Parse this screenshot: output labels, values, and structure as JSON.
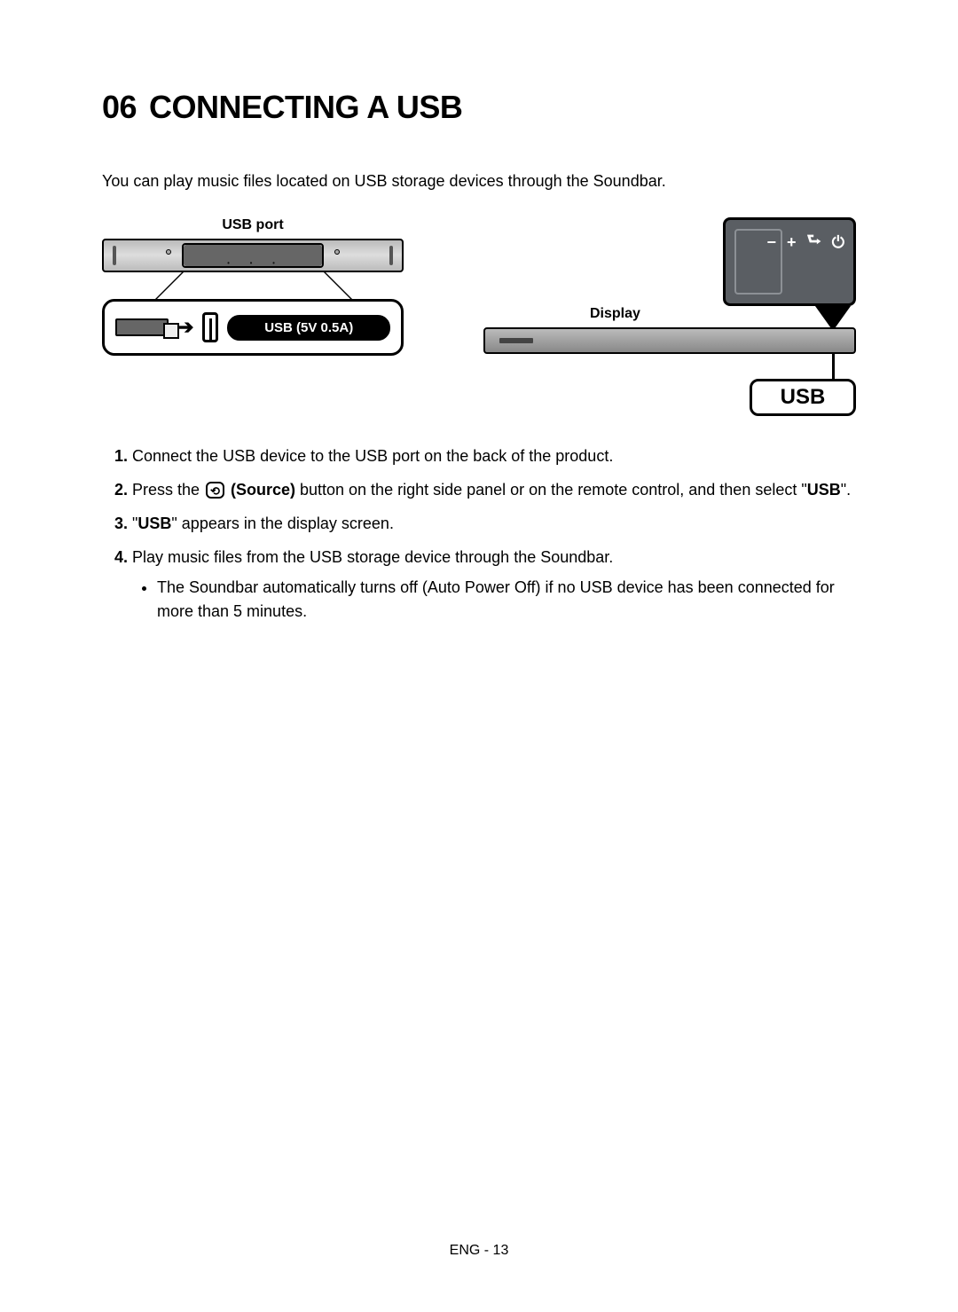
{
  "heading": {
    "number": "06",
    "title": "CONNECTING A USB"
  },
  "intro": "You can play music files located on USB storage devices through the Soundbar.",
  "diagram": {
    "usb_port_label": "USB port",
    "usb_spec_badge": "USB (5V 0.5A)",
    "display_label": "Display",
    "usb_display_text": "USB",
    "top_icons": {
      "minus": "−",
      "plus": "+",
      "source": "⮑",
      "power": "⏻"
    }
  },
  "steps": [
    {
      "text": "Connect the USB device to the USB port on the back of the product."
    },
    {
      "pre": "Press the ",
      "source_label": "(Source)",
      "mid": " button on the right side panel or on the remote control, and then select \"",
      "bold": "USB",
      "post": "\"."
    },
    {
      "pre": "\"",
      "bold": "USB",
      "post": "\" appears in the display screen."
    },
    {
      "text": "Play music files from the USB storage device through the Soundbar.",
      "sub": [
        "The Soundbar automatically turns off (Auto Power Off) if no USB device has been connected for more than 5 minutes."
      ]
    }
  ],
  "footer": "ENG - 13"
}
